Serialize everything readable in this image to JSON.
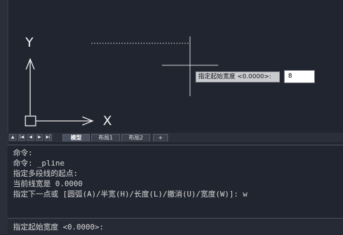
{
  "viewport": {
    "ucs": {
      "y_label": "Y",
      "x_label": "X"
    },
    "dynamic_input": {
      "prompt": "指定起始宽度 <0.0000>:",
      "value": "8"
    }
  },
  "layout_tabs": {
    "nav_buttons": [
      "▲",
      "|◀",
      "◀",
      "▶",
      "▶|"
    ],
    "tabs": [
      "模型",
      "布局1",
      "布局2",
      "+"
    ]
  },
  "command_history": [
    "命令:",
    "命令: _pline",
    "指定多段线的起点:",
    "当前线宽是 0.0000",
    "指定下一点或 [圆弧(A)/半宽(H)/长度(L)/撤消(U)/宽度(W)]: w"
  ],
  "command_prompt": "指定起始宽度 <0.0000>:",
  "colors": {
    "viewport_bg": "#212530",
    "crosshair": "#d0d0d0",
    "tooltip_bg": "#c9cbcf"
  }
}
